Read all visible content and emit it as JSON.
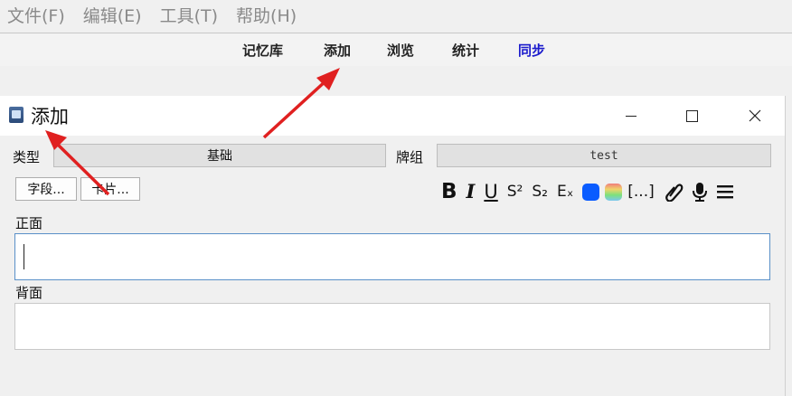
{
  "menubar": {
    "items": [
      "文件(F)",
      "编辑(E)",
      "工具(T)",
      "帮助(H)"
    ]
  },
  "main_toolbar": {
    "items": [
      "记忆库",
      "添加",
      "浏览",
      "统计",
      "同步"
    ]
  },
  "dialog": {
    "title": "添加",
    "type_label": "类型",
    "type_value": "基础",
    "deck_label": "牌组",
    "deck_value": "test",
    "fields_button": "字段...",
    "cards_button": "卡片...",
    "format_toolbar": {
      "bold": "B",
      "italic": "I",
      "underline": "U",
      "superscript": "S²",
      "subscript": "S₂",
      "clear_format": "Eₓ",
      "cloze": "[...]",
      "icons": [
        "text-color-icon",
        "highlight-color-icon",
        "attach-icon",
        "record-audio-icon",
        "more-menu-icon"
      ]
    },
    "front_label": "正面",
    "back_label": "背面",
    "front_value": "",
    "back_value": ""
  },
  "colors": {
    "accent_blue": "#0a5cff",
    "annotation_red": "#e02020",
    "sync_blue": "#1a1acc"
  }
}
